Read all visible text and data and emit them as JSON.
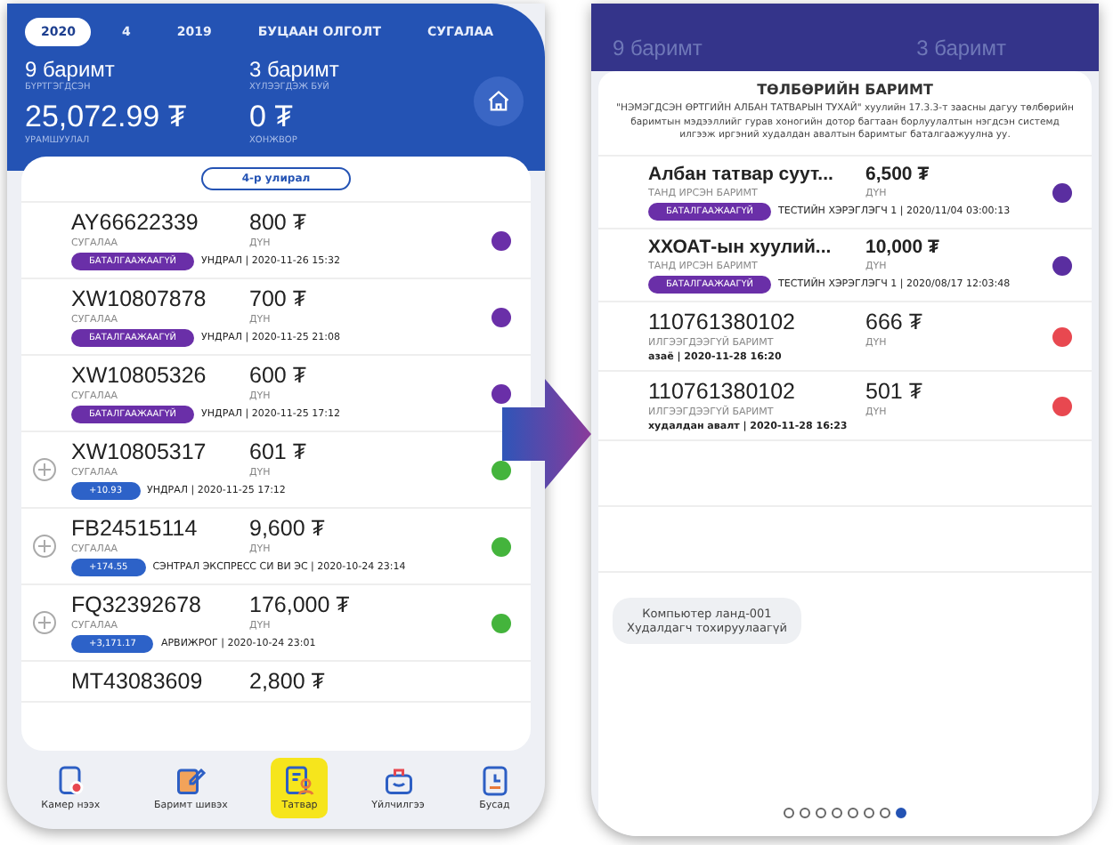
{
  "left_phone": {
    "tabs": [
      {
        "label": "2020",
        "selected": true
      },
      {
        "label": "4",
        "selected": false
      },
      {
        "label": "2019",
        "selected": false
      },
      {
        "label": "БУЦААН ОЛГОЛТ",
        "selected": false
      },
      {
        "label": "СУГАЛАА",
        "selected": false
      }
    ],
    "stats": [
      {
        "value": "9 баримт",
        "label": "БҮРТГЭГДСЭН"
      },
      {
        "value": "3 баримт",
        "label": "ХҮЛЭЭГДЭЖ БУЙ"
      },
      {
        "value": "25,072.99 ₮",
        "label": "УРАМШУУЛАЛ"
      },
      {
        "value": "0 ₮",
        "label": "ХОНЖВОР"
      }
    ],
    "season": "4-р улирал",
    "receipts": [
      {
        "kind": "unconfirmed",
        "code": "AY66622339",
        "type": "СУГАЛАА",
        "amount": "800 ₮",
        "amount_label": "ДҮН",
        "badge": "БАТАЛГААЖААГҮЙ",
        "meta": "УНДРАЛ | 2020-11-26 15:32",
        "color": "#6a2fa8"
      },
      {
        "kind": "unconfirmed",
        "code": "XW10807878",
        "type": "СУГАЛАА",
        "amount": "700 ₮",
        "amount_label": "ДҮН",
        "badge": "БАТАЛГААЖААГҮЙ",
        "meta": "УНДРАЛ | 2020-11-25 21:08",
        "color": "#6a2fa8"
      },
      {
        "kind": "unconfirmed",
        "code": "XW10805326",
        "type": "СУГАЛАА",
        "amount": "600 ₮",
        "amount_label": "ДҮН",
        "badge": "БАТАЛГААЖААГҮЙ",
        "meta": "УНДРАЛ | 2020-11-25 17:12",
        "color": "#6a2fa8"
      },
      {
        "kind": "bonus",
        "code": "XW10805317",
        "type": "СУГАЛАА",
        "amount": "601 ₮",
        "amount_label": "ДҮН",
        "badge": "+10.93",
        "meta": "УНДРАЛ | 2020-11-25 17:12",
        "color": "#44b43c"
      },
      {
        "kind": "bonus",
        "code": "FB24515114",
        "type": "СУГАЛАА",
        "amount": "9,600 ₮",
        "amount_label": "ДҮН",
        "badge": "+174.55",
        "meta": "СЭНТРАЛ ЭКСПРЕСС СИ ВИ ЭС | 2020-10-24 23:14",
        "color": "#44b43c"
      },
      {
        "kind": "bonus",
        "code": "FQ32392678",
        "type": "СУГАЛАА",
        "amount": "176,000 ₮",
        "amount_label": "ДҮН",
        "badge": "+3,171.17",
        "meta": "АРВИЖРОГ | 2020-10-24 23:01",
        "color": "#44b43c"
      },
      {
        "kind": "partial",
        "code": "MT43083609",
        "amount": "2,800 ₮"
      }
    ],
    "nav": [
      {
        "label": "Камер нээх",
        "selected": false
      },
      {
        "label": "Баримт шивэх",
        "selected": false
      },
      {
        "label": "Татвар",
        "selected": true
      },
      {
        "label": "Үйлчилгээ",
        "selected": false
      },
      {
        "label": "Бусад",
        "selected": false
      }
    ]
  },
  "right_phone": {
    "background_stats": [
      "9 баримт",
      "3 баримт"
    ],
    "title": "ТӨЛБӨРИЙН БАРИМТ",
    "notice": "\"НЭМЭГДСЭН ӨРТГИЙН АЛБАН ТАТВАРЫН ТУХАЙ\" хуулийн 17.3.3-т заасны дагуу төлбөрийн баримтын мэдээллийг гурав хоногийн дотор багтаан борлуулалтын нэгдсэн системд илгээж иргэний худалдан авалтын баримтыг баталгаажуулна уу.",
    "receipts": [
      {
        "kind": "unconfirmed",
        "code": "Албан татвар суут...",
        "type": "ТАНД ИРСЭН БАРИМТ",
        "amount": "6,500 ₮",
        "amount_label": "ДҮН",
        "badge": "БАТАЛГААЖААГҮЙ",
        "meta": "ТЕСТИЙН ХЭРЭГЛЭГЧ 1 | 2020/11/04 03:00:13",
        "color": "#5a2ea0"
      },
      {
        "kind": "unconfirmed",
        "code": "ХХОАТ-ын хуулий...",
        "type": "ТАНД ИРСЭН БАРИМТ",
        "amount": "10,000 ₮",
        "amount_label": "ДҮН",
        "badge": "БАТАЛГААЖААГҮЙ",
        "meta": "ТЕСТИЙН ХЭРЭГЛЭГЧ 1 | 2020/08/17 12:03:48",
        "color": "#5a2ea0"
      },
      {
        "kind": "unsent",
        "code": "110761380102",
        "type": "ИЛГЭЭГДЭЭГҮЙ БАРИМТ",
        "amount": "666 ₮",
        "amount_label": "ДҮН",
        "meta": "азаё | 2020-11-28 16:20",
        "color": "#e84850"
      },
      {
        "kind": "unsent",
        "code": "110761380102",
        "type": "ИЛГЭЭГДЭЭГҮЙ БАРИМТ",
        "amount": "501 ₮",
        "amount_label": "ДҮН",
        "meta": "худалдан авалт | 2020-11-28 16:23",
        "color": "#e84850"
      }
    ],
    "merchant": [
      "Компьютер ланд-001",
      "Худалдагч тохируулаагүй"
    ],
    "pages": [
      {
        "selected": false
      },
      {
        "selected": false
      },
      {
        "selected": false
      },
      {
        "selected": false
      },
      {
        "selected": false
      },
      {
        "selected": false
      },
      {
        "selected": false
      },
      {
        "selected": true
      }
    ]
  }
}
